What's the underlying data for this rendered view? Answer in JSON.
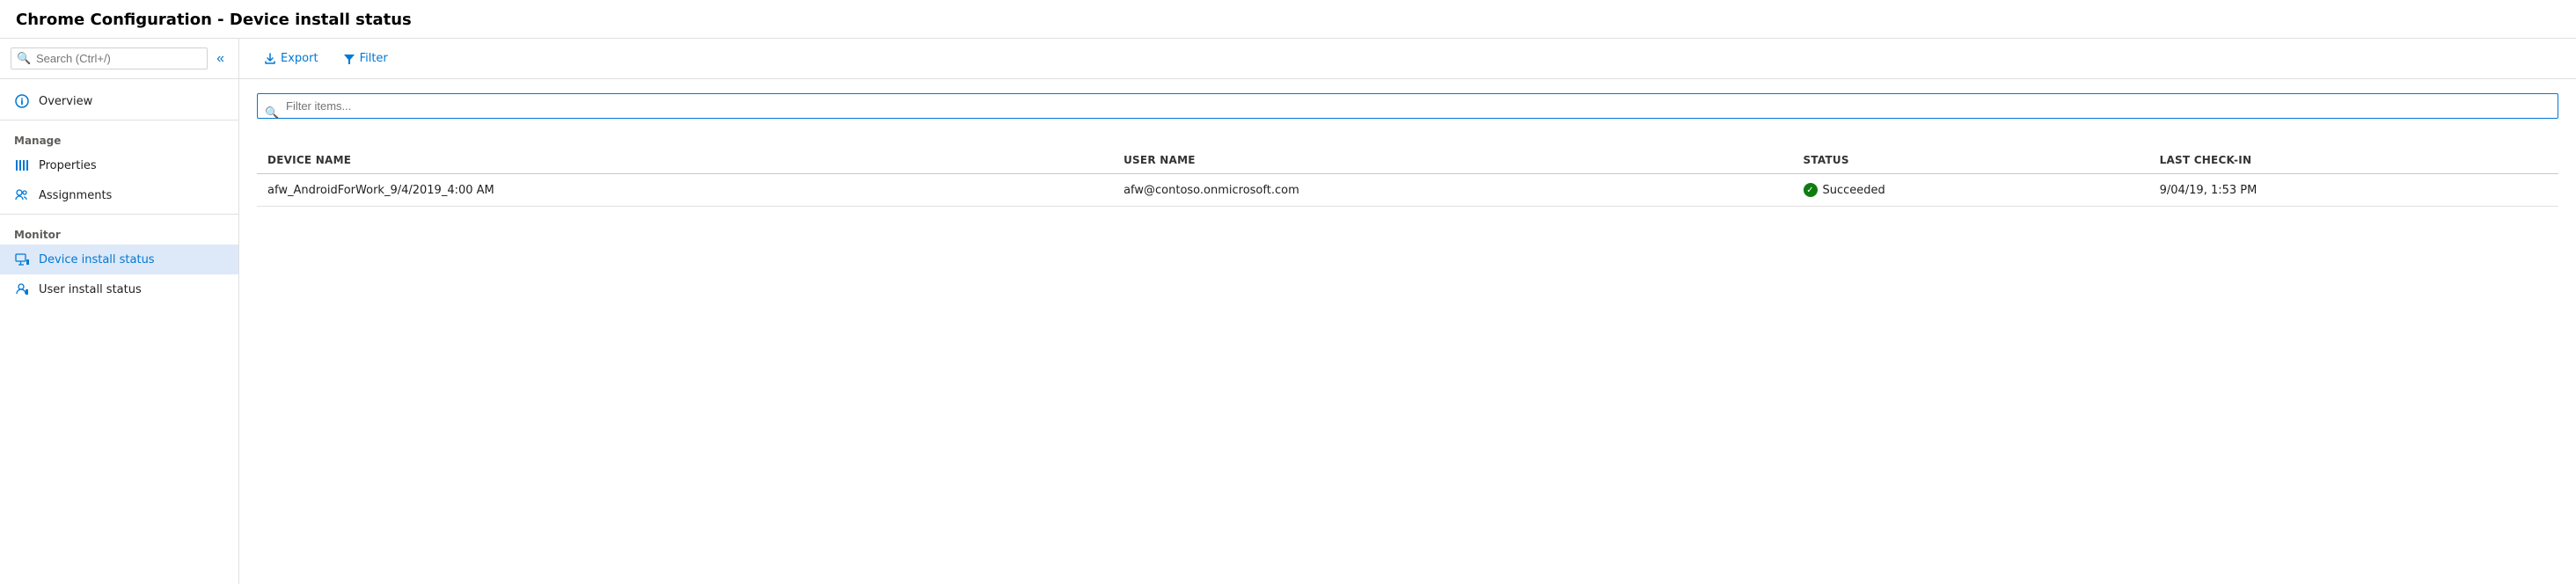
{
  "titleBar": {
    "title": "Chrome Configuration - Device install status"
  },
  "sidebar": {
    "search": {
      "placeholder": "Search (Ctrl+/)"
    },
    "collapseLabel": "«",
    "sections": [
      {
        "label": "",
        "items": [
          {
            "id": "overview",
            "label": "Overview",
            "icon": "info-icon",
            "active": false
          }
        ]
      },
      {
        "label": "Manage",
        "items": [
          {
            "id": "properties",
            "label": "Properties",
            "icon": "properties-icon",
            "active": false
          },
          {
            "id": "assignments",
            "label": "Assignments",
            "icon": "assignments-icon",
            "active": false
          }
        ]
      },
      {
        "label": "Monitor",
        "items": [
          {
            "id": "device-install-status",
            "label": "Device install status",
            "icon": "device-status-icon",
            "active": true
          },
          {
            "id": "user-install-status",
            "label": "User install status",
            "icon": "user-status-icon",
            "active": false
          }
        ]
      }
    ]
  },
  "toolbar": {
    "exportLabel": "Export",
    "filterLabel": "Filter"
  },
  "tableArea": {
    "filterPlaceholder": "Filter items...",
    "columns": [
      {
        "key": "deviceName",
        "label": "DEVICE NAME"
      },
      {
        "key": "userName",
        "label": "USER NAME"
      },
      {
        "key": "status",
        "label": "STATUS"
      },
      {
        "key": "lastCheckin",
        "label": "LAST CHECK-IN"
      }
    ],
    "rows": [
      {
        "deviceName": "afw_AndroidForWork_9/4/2019_4:00 AM",
        "userName": "afw@contoso.onmicrosoft.com",
        "status": "Succeeded",
        "statusType": "success",
        "lastCheckin": "9/04/19, 1:53 PM"
      }
    ]
  }
}
